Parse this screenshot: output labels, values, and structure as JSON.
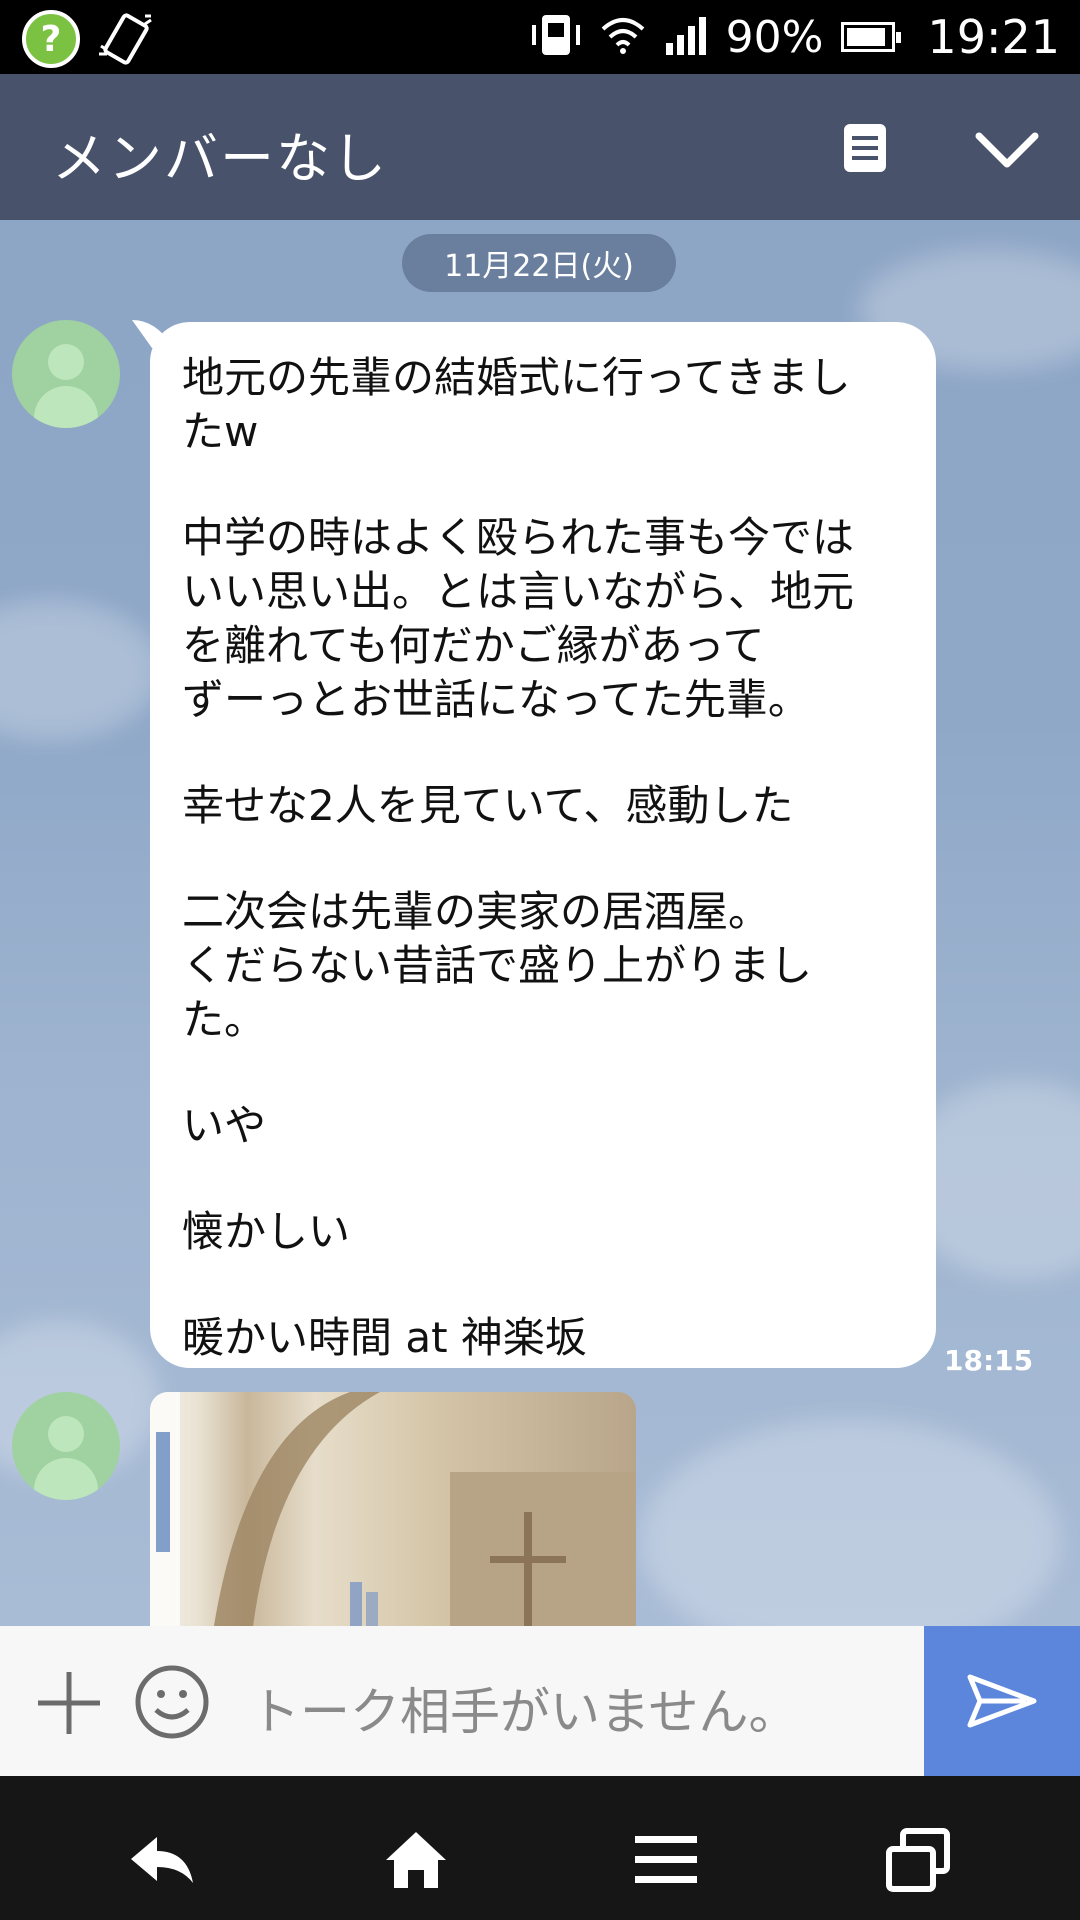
{
  "status_bar": {
    "battery_percent": "90%",
    "battery_level": 0.9,
    "time": "19:21",
    "icons": [
      "help-icon",
      "rotate-icon",
      "vibrate-icon",
      "wifi-icon",
      "signal-icon",
      "battery-icon"
    ]
  },
  "header": {
    "title": "メンバーなし",
    "icons": [
      "memo-icon",
      "chevron-down-icon"
    ]
  },
  "chat": {
    "date": "11月22日(火)",
    "message": {
      "lines": [
        "地元の先輩の結婚式に行ってきまし",
        "たw",
        "",
        "中学の時はよく殴られた事も今では",
        "いい思い出。とは言いながら、地元",
        "を離れても何だかご縁があって",
        "ずーっとお世話になってた先輩。",
        "",
        "幸せな2人を見ていて、感動した",
        "",
        "二次会は先輩の実家の居酒屋。",
        "くだらない昔話で盛り上がりまし",
        "た。",
        "",
        "いや",
        "",
        "懐かしい",
        "",
        "暖かい時間  at 神楽坂"
      ],
      "time": "18:15"
    }
  },
  "input": {
    "placeholder": "トーク相手がいません。",
    "icons": [
      "plus-icon",
      "smiley-icon",
      "send-icon"
    ]
  },
  "nav": {
    "icons": [
      "back-icon",
      "home-icon",
      "menu-icon",
      "recent-apps-icon"
    ]
  },
  "colors": {
    "header_bg": "#48536b",
    "chat_bg": "#8fa8c8",
    "send_bg": "#5b86db",
    "date_pill": "#6a7f9e"
  }
}
